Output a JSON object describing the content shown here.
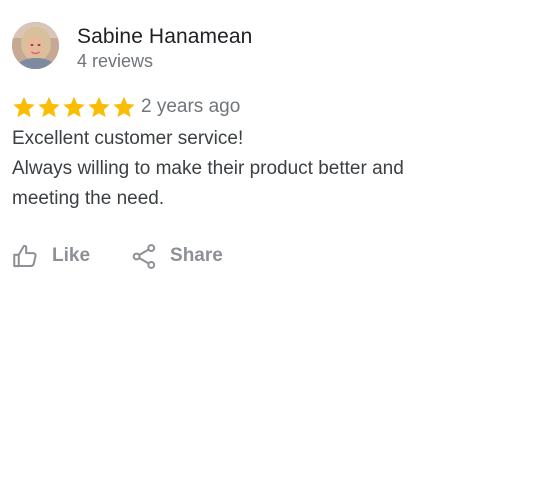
{
  "review": {
    "author": {
      "name": "Sabine Hanamean",
      "review_count": "4 reviews",
      "avatar_icon": "user-avatar-photo"
    },
    "rating": {
      "stars": 5,
      "max_stars": 5,
      "star_color": "#fbbc04"
    },
    "timestamp": "2 years ago",
    "text_lines": [
      "Excellent customer service!",
      "Always willing to make their product better and",
      "meeting the need."
    ],
    "actions": {
      "like_label": "Like",
      "like_icon": "thumb-up-icon",
      "share_label": "Share",
      "share_icon": "share-icon"
    }
  },
  "colors": {
    "author_name": "#202124",
    "secondary_text": "#70757a",
    "body_text": "#3c4043",
    "action_text": "#8d9095"
  }
}
